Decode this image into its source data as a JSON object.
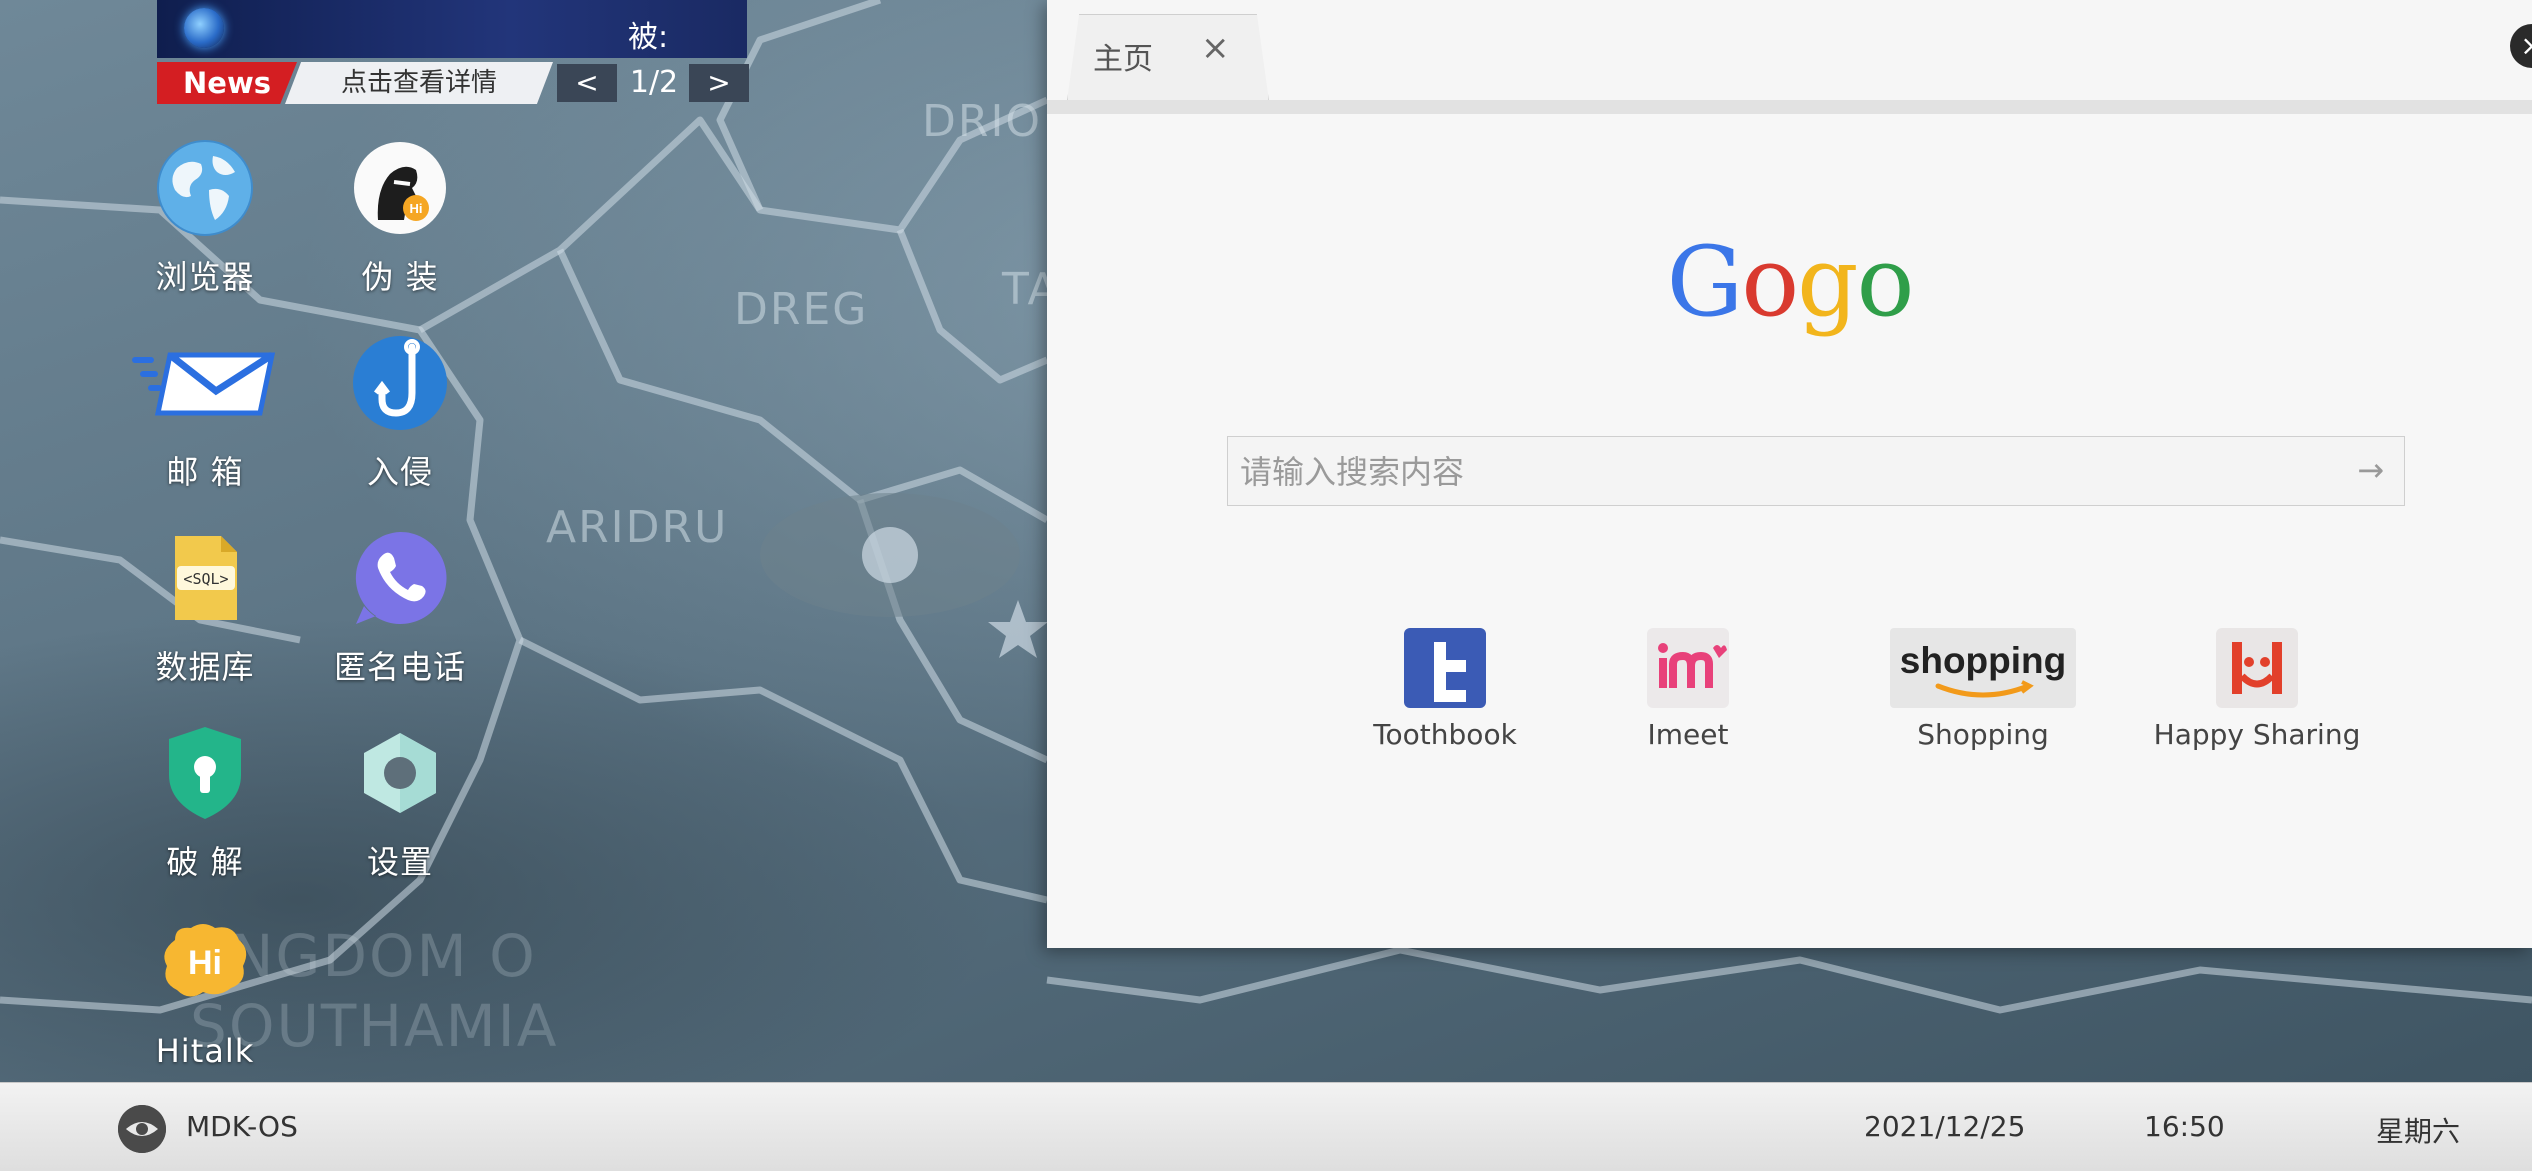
{
  "news": {
    "headline": "被:",
    "tag": "News",
    "detail_link": "点击查看详情",
    "prev_symbol": "<",
    "next_symbol": ">",
    "page": "1/2"
  },
  "map": {
    "labels": [
      "DRIO",
      "DREG",
      "TA",
      "ARIDRU",
      "NGDOM O",
      "SOUTHAMIA"
    ]
  },
  "desktop": {
    "apps": [
      {
        "label": "浏览器",
        "icon": "globe-icon"
      },
      {
        "label": "伪 装",
        "icon": "disguise-icon"
      },
      {
        "label": "邮 箱",
        "icon": "mail-icon"
      },
      {
        "label": "入侵",
        "icon": "hook-icon"
      },
      {
        "label": "数据库",
        "icon": "sql-file-icon"
      },
      {
        "label": "匿名电话",
        "icon": "phone-icon"
      },
      {
        "label": "破 解",
        "icon": "keyhole-shield-icon"
      },
      {
        "label": "设置",
        "icon": "hex-gear-icon"
      },
      {
        "label": "Hitalk",
        "icon": "hi-bubble-icon"
      }
    ]
  },
  "browser": {
    "tab_label": "主页",
    "tab_close": "×",
    "window_close": "×",
    "logo_letters": [
      {
        "ch": "G",
        "color": "#3b76e8"
      },
      {
        "ch": "o",
        "color": "#d93a2f"
      },
      {
        "ch": "g",
        "color": "#f2b51c"
      },
      {
        "ch": "o",
        "color": "#2f9e49"
      }
    ],
    "search_placeholder": "请输入搜索内容",
    "search_go": "→",
    "shortcuts": [
      {
        "label": "Toothbook",
        "icon": "toothbook-icon",
        "color": "#3b5bb5"
      },
      {
        "label": "Imeet",
        "icon": "imeet-icon",
        "color": "#e8417a"
      },
      {
        "label": "Shopping",
        "icon": "shopping-icon",
        "text": "shopping",
        "color": "#f29a1a"
      },
      {
        "label": "Happy Sharing",
        "icon": "happy-sharing-icon",
        "color": "#e2402b"
      }
    ]
  },
  "taskbar": {
    "os_name": "MDK-OS",
    "date": "2021/12/25",
    "time": "16:50",
    "weekday": "星期六"
  }
}
